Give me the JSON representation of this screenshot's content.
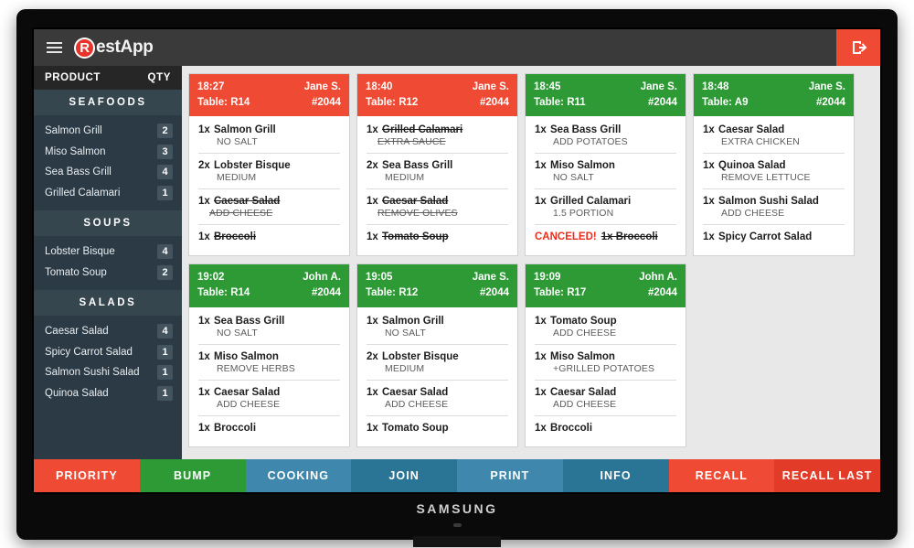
{
  "topbar": {
    "menu_icon": "hamburger-menu-icon",
    "logo_badge": "R",
    "logo_text": "estApp",
    "exit_icon": "exit-icon"
  },
  "sidebar": {
    "header": {
      "product": "PRODUCT",
      "qty": "QTY"
    },
    "sections": [
      {
        "title": "SEAFOODS",
        "items": [
          {
            "name": "Salmon Grill",
            "qty": "2"
          },
          {
            "name": "Miso Salmon",
            "qty": "3"
          },
          {
            "name": "Sea Bass Grill",
            "qty": "4"
          },
          {
            "name": "Grilled Calamari",
            "qty": "1"
          }
        ]
      },
      {
        "title": "SOUPS",
        "items": [
          {
            "name": "Lobster Bisque",
            "qty": "4"
          },
          {
            "name": "Tomato Soup",
            "qty": "2"
          }
        ]
      },
      {
        "title": "SALADS",
        "items": [
          {
            "name": "Caesar Salad",
            "qty": "4"
          },
          {
            "name": "Spicy Carrot Salad",
            "qty": "1"
          },
          {
            "name": "Salmon Sushi Salad",
            "qty": "1"
          },
          {
            "name": "Quinoa Salad",
            "qty": "1"
          }
        ]
      }
    ]
  },
  "orders": [
    {
      "time": "18:27",
      "server": "Jane S.",
      "table": "Table: R14",
      "order_no": "#2044",
      "status_color": "red",
      "items": [
        {
          "qty": "1x",
          "name": "Salmon Grill",
          "note": "NO SALT",
          "done": false,
          "canceled": false
        },
        {
          "qty": "2x",
          "name": "Lobster Bisque",
          "note": "MEDIUM",
          "done": false,
          "canceled": false
        },
        {
          "qty": "1x",
          "name": "Caesar Salad",
          "note": "ADD CHEESE",
          "done": true,
          "canceled": false
        },
        {
          "qty": "1x",
          "name": "Broccoli",
          "note": "",
          "done": true,
          "canceled": false
        }
      ]
    },
    {
      "time": "18:40",
      "server": "Jane S.",
      "table": "Table: R12",
      "order_no": "#2044",
      "status_color": "red",
      "items": [
        {
          "qty": "1x",
          "name": "Grilled Calamari",
          "note": "EXTRA SAUCE",
          "done": true,
          "canceled": false
        },
        {
          "qty": "2x",
          "name": "Sea Bass Grill",
          "note": "MEDIUM",
          "done": false,
          "canceled": false
        },
        {
          "qty": "1x",
          "name": "Caesar Salad",
          "note": "REMOVE OLIVES",
          "done": true,
          "canceled": false
        },
        {
          "qty": "1x",
          "name": "Tomato Soup",
          "note": "",
          "done": true,
          "canceled": false
        }
      ]
    },
    {
      "time": "18:45",
      "server": "Jane S.",
      "table": "Table: R11",
      "order_no": "#2044",
      "status_color": "green",
      "items": [
        {
          "qty": "1x",
          "name": "Sea Bass Grill",
          "note": "ADD POTATOES",
          "done": false,
          "canceled": false
        },
        {
          "qty": "1x",
          "name": "Miso Salmon",
          "note": "NO SALT",
          "done": false,
          "canceled": false
        },
        {
          "qty": "1x",
          "name": "Grilled Calamari",
          "note": "1.5 PORTION",
          "done": false,
          "canceled": false
        },
        {
          "qty": "1x",
          "name": "Broccoli",
          "note": "",
          "done": false,
          "canceled": true,
          "canceled_label": "CANCELED!"
        }
      ]
    },
    {
      "time": "18:48",
      "server": "Jane S.",
      "table": "Table: A9",
      "order_no": "#2044",
      "status_color": "green",
      "items": [
        {
          "qty": "1x",
          "name": "Caesar Salad",
          "note": "EXTRA CHICKEN",
          "done": false,
          "canceled": false
        },
        {
          "qty": "1x",
          "name": "Quinoa Salad",
          "note": "REMOVE LETTUCE",
          "done": false,
          "canceled": false
        },
        {
          "qty": "1x",
          "name": "Salmon Sushi Salad",
          "note": "ADD CHEESE",
          "done": false,
          "canceled": false
        },
        {
          "qty": "1x",
          "name": "Spicy Carrot Salad",
          "note": "",
          "done": false,
          "canceled": false
        }
      ]
    },
    {
      "time": "19:02",
      "server": "John A.",
      "table": "Table: R14",
      "order_no": "#2044",
      "status_color": "green",
      "items": [
        {
          "qty": "1x",
          "name": "Sea Bass Grill",
          "note": "NO SALT",
          "done": false,
          "canceled": false
        },
        {
          "qty": "1x",
          "name": "Miso Salmon",
          "note": "REMOVE HERBS",
          "done": false,
          "canceled": false
        },
        {
          "qty": "1x",
          "name": "Caesar Salad",
          "note": "ADD CHEESE",
          "done": false,
          "canceled": false
        },
        {
          "qty": "1x",
          "name": "Broccoli",
          "note": "",
          "done": false,
          "canceled": false
        }
      ]
    },
    {
      "time": "19:05",
      "server": "Jane S.",
      "table": "Table: R12",
      "order_no": "#2044",
      "status_color": "green",
      "items": [
        {
          "qty": "1x",
          "name": "Salmon Grill",
          "note": "NO SALT",
          "done": false,
          "canceled": false
        },
        {
          "qty": "2x",
          "name": "Lobster Bisque",
          "note": "MEDIUM",
          "done": false,
          "canceled": false
        },
        {
          "qty": "1x",
          "name": "Caesar Salad",
          "note": "ADD CHEESE",
          "done": false,
          "canceled": false
        },
        {
          "qty": "1x",
          "name": "Tomato Soup",
          "note": "",
          "done": false,
          "canceled": false
        }
      ]
    },
    {
      "time": "19:09",
      "server": "John A.",
      "table": "Table: R17",
      "order_no": "#2044",
      "status_color": "green",
      "items": [
        {
          "qty": "1x",
          "name": "Tomato Soup",
          "note": "ADD CHEESE",
          "done": false,
          "canceled": false
        },
        {
          "qty": "1x",
          "name": "Miso Salmon",
          "note": "+GRILLED POTATOES",
          "done": false,
          "canceled": false
        },
        {
          "qty": "1x",
          "name": "Caesar Salad",
          "note": "ADD CHEESE",
          "done": false,
          "canceled": false
        },
        {
          "qty": "1x",
          "name": "Broccoli",
          "note": "",
          "done": false,
          "canceled": false
        }
      ]
    }
  ],
  "actionbar": [
    {
      "label": "PRIORITY",
      "color": "#ef4a34"
    },
    {
      "label": "BUMP",
      "color": "#2d9a36"
    },
    {
      "label": "COOKING",
      "color": "#3f87ad"
    },
    {
      "label": "JOIN",
      "color": "#2a7496"
    },
    {
      "label": "PRINT",
      "color": "#3f87ad"
    },
    {
      "label": "INFO",
      "color": "#2a7496"
    },
    {
      "label": "RECALL",
      "color": "#ef4a34"
    },
    {
      "label": "RECALL LAST",
      "color": "#e23b28"
    }
  ],
  "monitor": {
    "brand": "SAMSUNG"
  }
}
